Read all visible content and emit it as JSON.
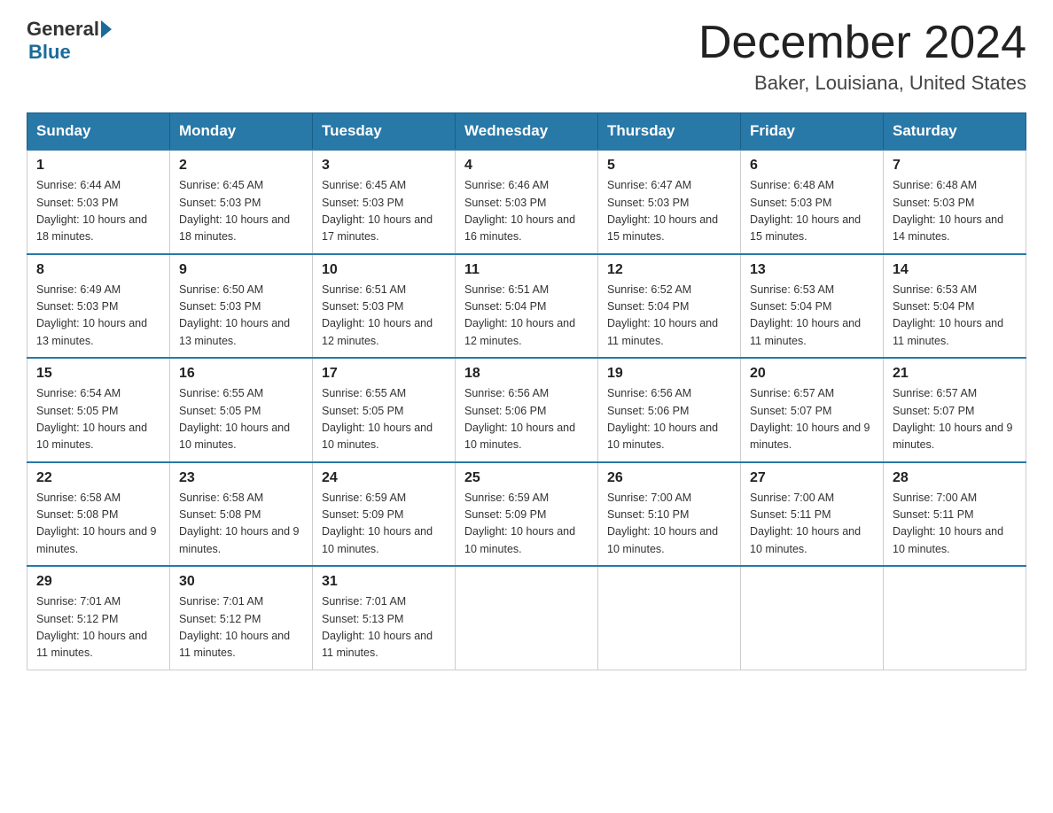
{
  "header": {
    "logo": {
      "general": "General",
      "blue": "Blue"
    },
    "title": "December 2024",
    "location": "Baker, Louisiana, United States"
  },
  "calendar": {
    "days_of_week": [
      "Sunday",
      "Monday",
      "Tuesday",
      "Wednesday",
      "Thursday",
      "Friday",
      "Saturday"
    ],
    "weeks": [
      [
        {
          "day": "1",
          "sunrise": "6:44 AM",
          "sunset": "5:03 PM",
          "daylight": "10 hours and 18 minutes."
        },
        {
          "day": "2",
          "sunrise": "6:45 AM",
          "sunset": "5:03 PM",
          "daylight": "10 hours and 18 minutes."
        },
        {
          "day": "3",
          "sunrise": "6:45 AM",
          "sunset": "5:03 PM",
          "daylight": "10 hours and 17 minutes."
        },
        {
          "day": "4",
          "sunrise": "6:46 AM",
          "sunset": "5:03 PM",
          "daylight": "10 hours and 16 minutes."
        },
        {
          "day": "5",
          "sunrise": "6:47 AM",
          "sunset": "5:03 PM",
          "daylight": "10 hours and 15 minutes."
        },
        {
          "day": "6",
          "sunrise": "6:48 AM",
          "sunset": "5:03 PM",
          "daylight": "10 hours and 15 minutes."
        },
        {
          "day": "7",
          "sunrise": "6:48 AM",
          "sunset": "5:03 PM",
          "daylight": "10 hours and 14 minutes."
        }
      ],
      [
        {
          "day": "8",
          "sunrise": "6:49 AM",
          "sunset": "5:03 PM",
          "daylight": "10 hours and 13 minutes."
        },
        {
          "day": "9",
          "sunrise": "6:50 AM",
          "sunset": "5:03 PM",
          "daylight": "10 hours and 13 minutes."
        },
        {
          "day": "10",
          "sunrise": "6:51 AM",
          "sunset": "5:03 PM",
          "daylight": "10 hours and 12 minutes."
        },
        {
          "day": "11",
          "sunrise": "6:51 AM",
          "sunset": "5:04 PM",
          "daylight": "10 hours and 12 minutes."
        },
        {
          "day": "12",
          "sunrise": "6:52 AM",
          "sunset": "5:04 PM",
          "daylight": "10 hours and 11 minutes."
        },
        {
          "day": "13",
          "sunrise": "6:53 AM",
          "sunset": "5:04 PM",
          "daylight": "10 hours and 11 minutes."
        },
        {
          "day": "14",
          "sunrise": "6:53 AM",
          "sunset": "5:04 PM",
          "daylight": "10 hours and 11 minutes."
        }
      ],
      [
        {
          "day": "15",
          "sunrise": "6:54 AM",
          "sunset": "5:05 PM",
          "daylight": "10 hours and 10 minutes."
        },
        {
          "day": "16",
          "sunrise": "6:55 AM",
          "sunset": "5:05 PM",
          "daylight": "10 hours and 10 minutes."
        },
        {
          "day": "17",
          "sunrise": "6:55 AM",
          "sunset": "5:05 PM",
          "daylight": "10 hours and 10 minutes."
        },
        {
          "day": "18",
          "sunrise": "6:56 AM",
          "sunset": "5:06 PM",
          "daylight": "10 hours and 10 minutes."
        },
        {
          "day": "19",
          "sunrise": "6:56 AM",
          "sunset": "5:06 PM",
          "daylight": "10 hours and 10 minutes."
        },
        {
          "day": "20",
          "sunrise": "6:57 AM",
          "sunset": "5:07 PM",
          "daylight": "10 hours and 9 minutes."
        },
        {
          "day": "21",
          "sunrise": "6:57 AM",
          "sunset": "5:07 PM",
          "daylight": "10 hours and 9 minutes."
        }
      ],
      [
        {
          "day": "22",
          "sunrise": "6:58 AM",
          "sunset": "5:08 PM",
          "daylight": "10 hours and 9 minutes."
        },
        {
          "day": "23",
          "sunrise": "6:58 AM",
          "sunset": "5:08 PM",
          "daylight": "10 hours and 9 minutes."
        },
        {
          "day": "24",
          "sunrise": "6:59 AM",
          "sunset": "5:09 PM",
          "daylight": "10 hours and 10 minutes."
        },
        {
          "day": "25",
          "sunrise": "6:59 AM",
          "sunset": "5:09 PM",
          "daylight": "10 hours and 10 minutes."
        },
        {
          "day": "26",
          "sunrise": "7:00 AM",
          "sunset": "5:10 PM",
          "daylight": "10 hours and 10 minutes."
        },
        {
          "day": "27",
          "sunrise": "7:00 AM",
          "sunset": "5:11 PM",
          "daylight": "10 hours and 10 minutes."
        },
        {
          "day": "28",
          "sunrise": "7:00 AM",
          "sunset": "5:11 PM",
          "daylight": "10 hours and 10 minutes."
        }
      ],
      [
        {
          "day": "29",
          "sunrise": "7:01 AM",
          "sunset": "5:12 PM",
          "daylight": "10 hours and 11 minutes."
        },
        {
          "day": "30",
          "sunrise": "7:01 AM",
          "sunset": "5:12 PM",
          "daylight": "10 hours and 11 minutes."
        },
        {
          "day": "31",
          "sunrise": "7:01 AM",
          "sunset": "5:13 PM",
          "daylight": "10 hours and 11 minutes."
        },
        null,
        null,
        null,
        null
      ]
    ]
  }
}
